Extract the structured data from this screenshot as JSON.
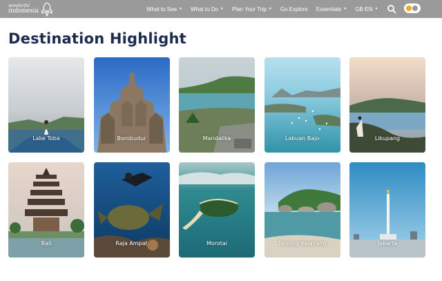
{
  "brand": {
    "line1": "wonderful",
    "line2": "indonesia"
  },
  "nav": {
    "items": [
      {
        "label": "What to See",
        "dropdown": true
      },
      {
        "label": "What to Do",
        "dropdown": true
      },
      {
        "label": "Plan Your Trip",
        "dropdown": true
      },
      {
        "label": "Go Explore",
        "dropdown": false
      },
      {
        "label": "Essentials",
        "dropdown": true
      },
      {
        "label": "GB-EN",
        "dropdown": true
      }
    ],
    "search_icon": "search-icon",
    "toggle_colors": {
      "track": "#ffffff",
      "on": "#f5a623"
    }
  },
  "page": {
    "title": "Destination Highlight"
  },
  "destinations": [
    {
      "name": "Lake Toba"
    },
    {
      "name": "Borobudur"
    },
    {
      "name": "Mandalika"
    },
    {
      "name": "Labuan Bajo"
    },
    {
      "name": "Likupang"
    },
    {
      "name": "Bali"
    },
    {
      "name": "Raja Ampat"
    },
    {
      "name": "Morotai"
    },
    {
      "name": "Tanjung Kelayang"
    },
    {
      "name": "Jakarta"
    }
  ],
  "colors": {
    "nav_bg": "#9a9a9a",
    "title": "#1d2b4f"
  }
}
